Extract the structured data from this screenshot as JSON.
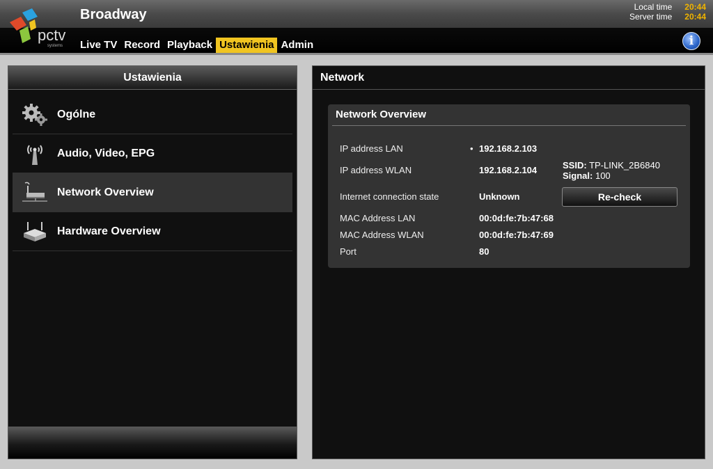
{
  "header": {
    "title": "Broadway",
    "local_time_label": "Local time",
    "local_time": "20:44",
    "server_time_label": "Server time",
    "server_time": "20:44",
    "info_icon": "info-icon",
    "logo_text": "pctv",
    "logo_subtext": "systems"
  },
  "nav": {
    "items": [
      {
        "label": "Live TV"
      },
      {
        "label": "Record"
      },
      {
        "label": "Playback"
      },
      {
        "label": "Ustawienia"
      },
      {
        "label": "Admin"
      }
    ],
    "active": "Ustawienia",
    "active_color": "#f0c420"
  },
  "sidebar": {
    "title": "Ustawienia",
    "items": [
      {
        "label": "Ogólne",
        "icon": "gears-icon"
      },
      {
        "label": "Audio, Video, EPG",
        "icon": "antenna-icon"
      },
      {
        "label": "Network Overview",
        "icon": "router-icon"
      },
      {
        "label": "Hardware Overview",
        "icon": "device-icon"
      }
    ],
    "selected": "Network Overview"
  },
  "main": {
    "title": "Network",
    "overview": {
      "title": "Network Overview",
      "ip_lan_label": "IP address LAN",
      "ip_lan": "192.168.2.103",
      "ip_wlan_label": "IP address WLAN",
      "ip_wlan": "192.168.2.104",
      "ssid_label": "SSID:",
      "ssid": "TP-LINK_2B6840",
      "signal_label": "Signal:",
      "signal": "100",
      "internet_label": "Internet connection state",
      "internet": "Unknown",
      "recheck_label": "Re-check",
      "mac_lan_label": "MAC Address LAN",
      "mac_lan": "00:0d:fe:7b:47:68",
      "mac_wlan_label": "MAC Address WLAN",
      "mac_wlan": "00:0d:fe:7b:47:69",
      "port_label": "Port",
      "port": "80"
    }
  }
}
